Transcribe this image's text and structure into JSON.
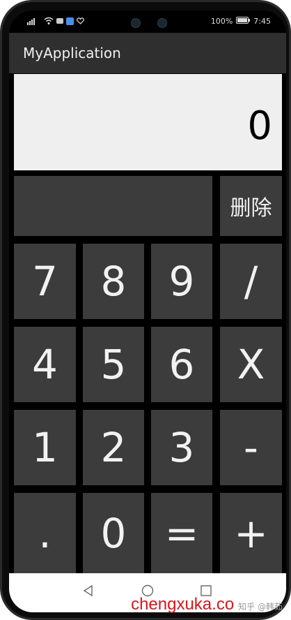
{
  "status_bar": {
    "battery": "100%",
    "time": "7:45"
  },
  "app": {
    "title": "MyApplication"
  },
  "display": {
    "value": "0"
  },
  "keys": {
    "delete": "删除",
    "k7": "7",
    "k8": "8",
    "k9": "9",
    "div": "/",
    "k4": "4",
    "k5": "5",
    "k6": "6",
    "mul": "X",
    "k1": "1",
    "k2": "2",
    "k3": "3",
    "sub": "-",
    "dot": ".",
    "k0": "0",
    "eq": "=",
    "add": "+"
  },
  "watermark": {
    "main": "chengxuka.co",
    "sub": "知乎 @韩茹"
  },
  "colors": {
    "key_bg": "#3b3c3b",
    "display_bg": "#efefef",
    "appbar_bg": "#2f2f2f",
    "watermark": "#d8161b"
  }
}
